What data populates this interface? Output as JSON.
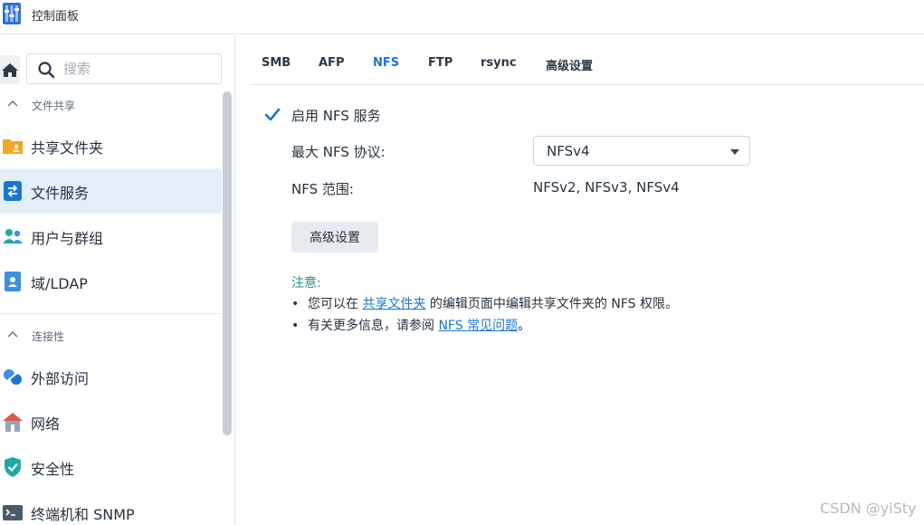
{
  "window": {
    "title": "控制面板",
    "icon": "control-panel-icon"
  },
  "sidebar": {
    "search_placeholder": "搜索",
    "groups": [
      {
        "label": "文件共享",
        "items": [
          {
            "label": "共享文件夹",
            "icon": "shared-folder-icon"
          },
          {
            "label": "文件服务",
            "icon": "file-services-icon",
            "active": true
          },
          {
            "label": "用户与群组",
            "icon": "users-groups-icon"
          },
          {
            "label": "域/LDAP",
            "icon": "domain-ldap-icon"
          }
        ]
      },
      {
        "label": "连接性",
        "items": [
          {
            "label": "外部访问",
            "icon": "external-access-icon"
          },
          {
            "label": "网络",
            "icon": "network-icon"
          },
          {
            "label": "安全性",
            "icon": "security-icon"
          },
          {
            "label": "终端机和 SNMP",
            "icon": "terminal-snmp-icon"
          }
        ]
      }
    ]
  },
  "tabs": [
    {
      "label": "SMB"
    },
    {
      "label": "AFP"
    },
    {
      "label": "NFS",
      "active": true
    },
    {
      "label": "FTP"
    },
    {
      "label": "rsync"
    },
    {
      "label": "高级设置"
    }
  ],
  "nfs": {
    "enable_label": "启用 NFS 服务",
    "enabled": true,
    "max_protocol_label": "最大 NFS 协议:",
    "max_protocol_value": "NFSv4",
    "range_label": "NFS 范围:",
    "range_value": "NFSv2, NFSv3, NFSv4",
    "advanced_button": "高级设置"
  },
  "notes": {
    "title": "注意:",
    "line1": {
      "prefix": "您可以在 ",
      "link": "共享文件夹",
      "suffix": " 的编辑页面中编辑共享文件夹的 NFS 权限。"
    },
    "line2": {
      "prefix": "有关更多信息，请参阅 ",
      "link": "NFS 常见问题",
      "suffix": "。"
    }
  },
  "watermark": "CSDN @yiSty",
  "colors": {
    "accent": "#1b76d2",
    "active_bg": "#e3eefb",
    "note": "#1f8f86"
  }
}
